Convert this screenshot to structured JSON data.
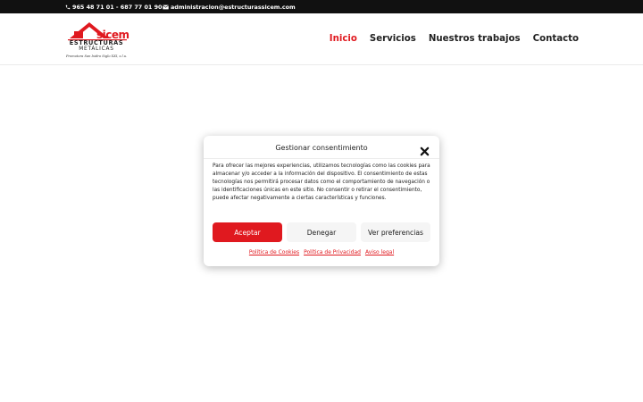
{
  "topbar": {
    "phone": "965 48 71 01 - 687 77 01 90",
    "email": "administracion@estructurassicem.com"
  },
  "logo": {
    "brand": "sicem",
    "line1": "ESTRUCTURAS",
    "line2": "METÁLICAS",
    "tagline": "Promotora San Isidro Siglo XXI, s.l.u."
  },
  "nav": {
    "items": [
      {
        "label": "Inicio",
        "active": true
      },
      {
        "label": "Servicios",
        "active": false
      },
      {
        "label": "Nuestros trabajos",
        "active": false
      },
      {
        "label": "Contacto",
        "active": false
      }
    ]
  },
  "consent": {
    "title": "Gestionar consentimiento",
    "body": "Para ofrecer las mejores experiencias, utilizamos tecnologías como las cookies para almacenar y/o acceder a la información del dispositivo. El consentimiento de estas tecnologías nos permitirá procesar datos como el comportamiento de navegación o las identificaciones únicas en este sitio. No consentir o retirar el consentimiento, puede afectar negativamente a ciertas características y funciones.",
    "accept_label": "Aceptar",
    "deny_label": "Denegar",
    "prefs_label": "Ver preferencias",
    "links": {
      "cookies": "Política de Cookies",
      "privacy": "Política de Privacidad",
      "legal": "Aviso legal"
    }
  },
  "colors": {
    "accent": "#e0191f",
    "topbar_bg": "#111111"
  },
  "icons": {
    "phone": "phone-icon",
    "mail": "mail-icon",
    "close": "close-icon"
  }
}
